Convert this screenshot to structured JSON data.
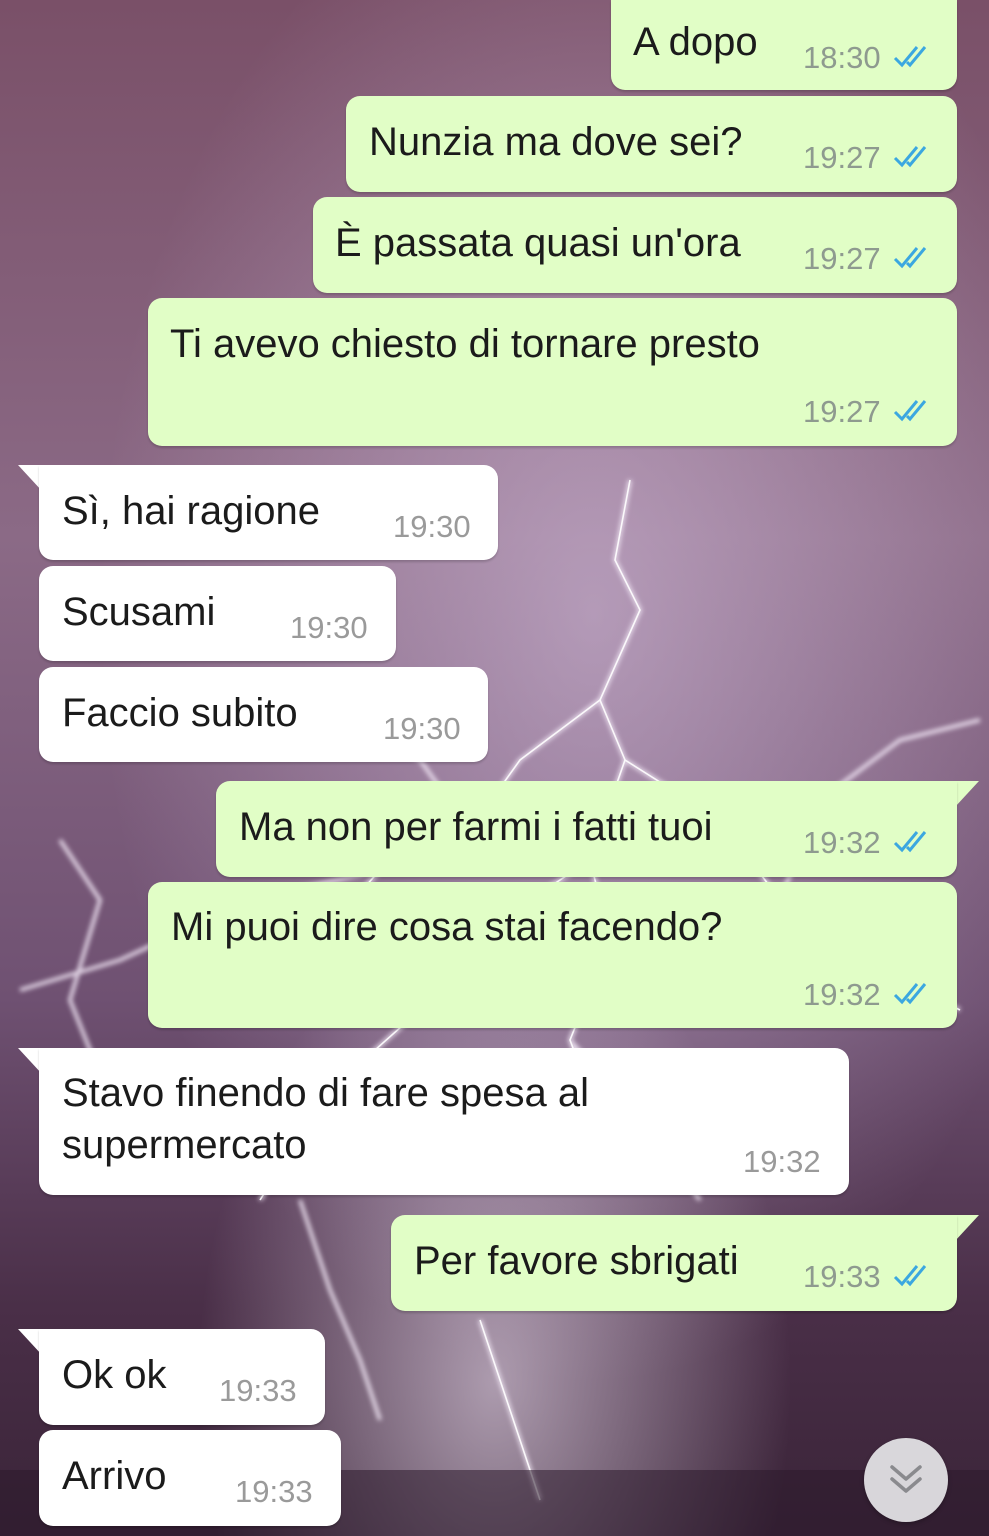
{
  "colors": {
    "outgoing_bubble": "#e1fec6",
    "incoming_bubble": "#ffffff",
    "read_ticks": "#3ba7e0",
    "timestamp": "#8e9a8f"
  },
  "messages": [
    {
      "id": "m1",
      "direction": "outgoing",
      "text": "A dopo",
      "time": "18:30",
      "status": "read"
    },
    {
      "id": "m2",
      "direction": "outgoing",
      "text": "Nunzia ma dove sei?",
      "time": "19:27",
      "status": "read"
    },
    {
      "id": "m3",
      "direction": "outgoing",
      "text": "È passata quasi un'ora",
      "time": "19:27",
      "status": "read"
    },
    {
      "id": "m4",
      "direction": "outgoing",
      "text": "Ti avevo chiesto di tornare presto",
      "time": "19:27",
      "status": "read"
    },
    {
      "id": "m5",
      "direction": "incoming",
      "text": "Sì, hai ragione",
      "time": "19:30"
    },
    {
      "id": "m6",
      "direction": "incoming",
      "text": "Scusami",
      "time": "19:30"
    },
    {
      "id": "m7",
      "direction": "incoming",
      "text": "Faccio subito",
      "time": "19:30"
    },
    {
      "id": "m8",
      "direction": "outgoing",
      "text": "Ma non per farmi i fatti tuoi",
      "time": "19:32",
      "status": "read"
    },
    {
      "id": "m9",
      "direction": "outgoing",
      "text": "Mi puoi dire cosa stai facendo?",
      "time": "19:32",
      "status": "read"
    },
    {
      "id": "m10",
      "direction": "incoming",
      "text_line1": "Stavo finendo di fare spesa al",
      "text_line2": "supermercato",
      "time": "19:32"
    },
    {
      "id": "m11",
      "direction": "outgoing",
      "text": "Per favore sbrigati",
      "time": "19:33",
      "status": "read"
    },
    {
      "id": "m12",
      "direction": "incoming",
      "text": "Ok ok",
      "time": "19:33"
    },
    {
      "id": "m13",
      "direction": "incoming",
      "text": "Arrivo",
      "time": "19:33"
    }
  ],
  "scroll_button": {
    "icon": "double-chevron-down-icon"
  }
}
